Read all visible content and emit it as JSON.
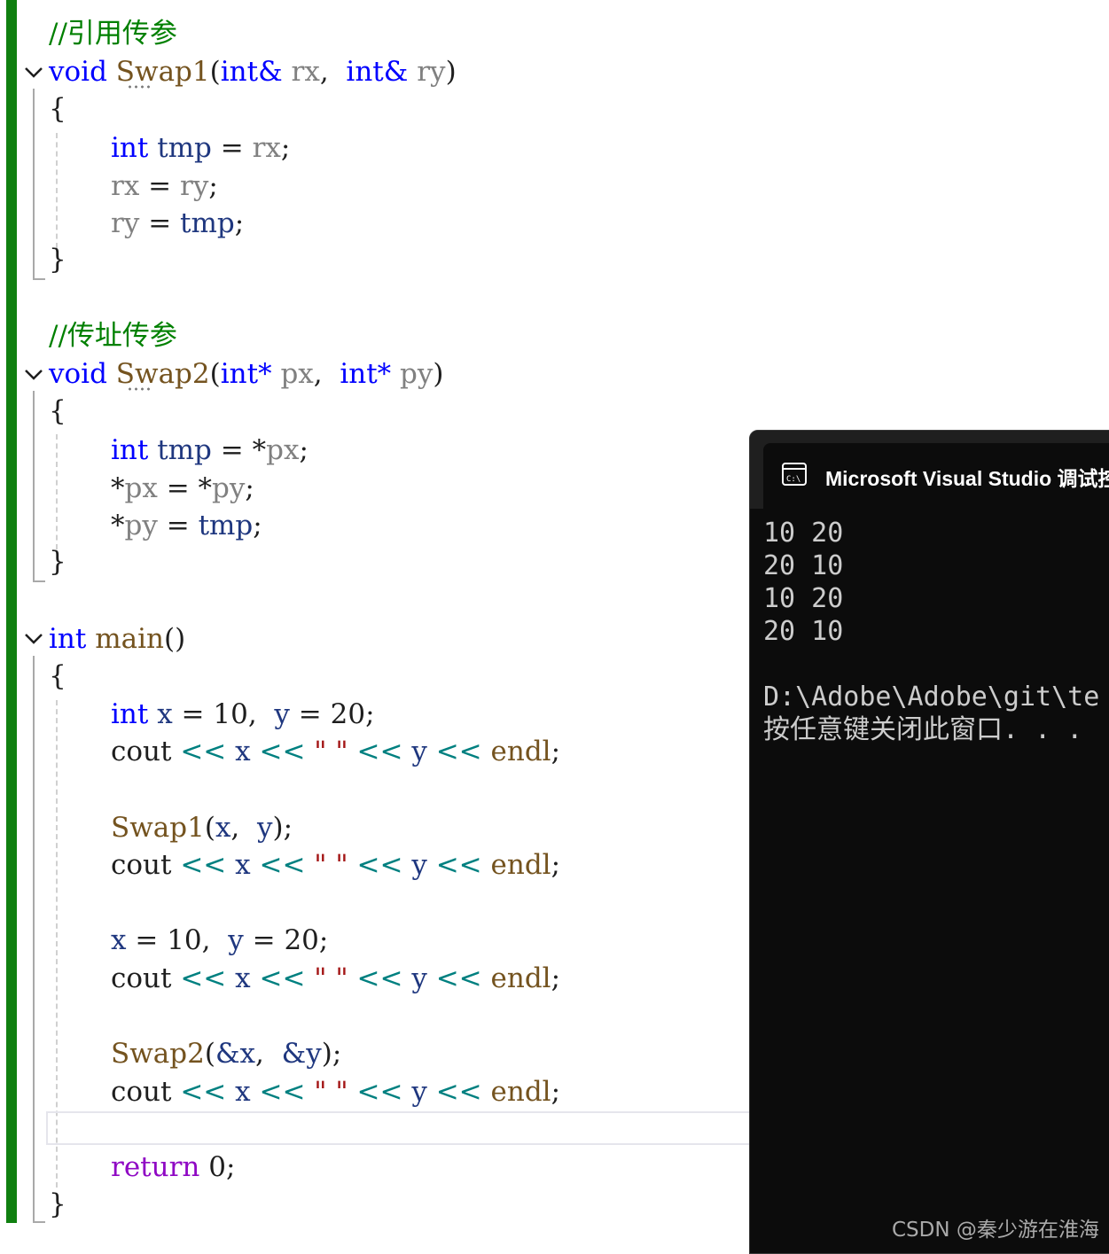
{
  "editor": {
    "comment_ref": "//引用传参",
    "comment_ptr": "//传址传参",
    "swap1": {
      "kw_void": "void",
      "name": "Swap1",
      "open_paren": "(",
      "type1": "int&",
      "p1": "rx",
      "comma": ",",
      "type2": "int&",
      "p2": "ry",
      "close_paren": ")",
      "open_brace": "{",
      "l1_kw": "int",
      "l1_var": "tmp",
      "l1_eq": "=",
      "l1_rhs": "rx",
      "l1_semi": ";",
      "l2_lhs": "rx",
      "l2_eq": "=",
      "l2_rhs": "ry",
      "l2_semi": ";",
      "l3_lhs": "ry",
      "l3_eq": "=",
      "l3_rhs": "tmp",
      "l3_semi": ";",
      "close_brace": "}"
    },
    "swap2": {
      "kw_void": "void",
      "name": "Swap2",
      "open_paren": "(",
      "type1": "int*",
      "p1": "px",
      "comma": ",",
      "type2": "int*",
      "p2": "py",
      "close_paren": ")",
      "open_brace": "{",
      "l1_kw": "int",
      "l1_var": "tmp",
      "l1_eq": "=",
      "l1_star": "*",
      "l1_rhs": "px",
      "l1_semi": ";",
      "l2_star1": "*",
      "l2_lhs": "px",
      "l2_eq": "=",
      "l2_star2": "*",
      "l2_rhs": "py",
      "l2_semi": ";",
      "l3_star": "*",
      "l3_lhs": "py",
      "l3_eq": "=",
      "l3_rhs": "tmp",
      "l3_semi": ";",
      "close_brace": "}"
    },
    "main": {
      "kw_int": "int",
      "name": "main",
      "parens": "()",
      "open_brace": "{",
      "decl": {
        "kw": "int",
        "x": "x",
        "eq1": "=",
        "v1": "10,",
        "y": "y",
        "eq2": "=",
        "v2": "20",
        "semi": ";"
      },
      "cout1": {
        "cout": "cout",
        "op": "<<",
        "x": "x",
        "str": "\" \"",
        "y": "y",
        "endl": "endl",
        "semi": ";"
      },
      "call1": {
        "name": "Swap1",
        "open": "(",
        "a1": "x",
        "comma": ",",
        "a2": "y",
        "close": ")",
        "semi": ";"
      },
      "assign": {
        "x": "x",
        "eq1": "=",
        "v1": "10,",
        "y": "y",
        "eq2": "=",
        "v2": "20",
        "semi": ";"
      },
      "call2": {
        "name": "Swap2",
        "open": "(",
        "a1": "&x",
        "comma": ",",
        "a2": "&y",
        "close": ")",
        "semi": ";"
      },
      "ret": {
        "kw": "return",
        "val": "0",
        "semi": ";"
      },
      "close_brace": "}"
    }
  },
  "console": {
    "title": "Microsoft Visual Studio 调试控制台",
    "output": [
      "10 20",
      "20 10",
      "10 20",
      "20 10"
    ],
    "path_line": "D:\\Adobe\\Adobe\\git\\te",
    "prompt_line": "按任意键关闭此窗口. . ."
  },
  "watermark": "CSDN @秦少游在淮海",
  "colors": {
    "keyword": "#0000ff",
    "function": "#74531f",
    "parameter": "#808080",
    "variable": "#1f377f",
    "string": "#a31515",
    "operator": "#008080",
    "comment": "#008000",
    "control": "#8f08c4",
    "change_bar": "#108010",
    "console_bg": "#0c0c0c"
  }
}
